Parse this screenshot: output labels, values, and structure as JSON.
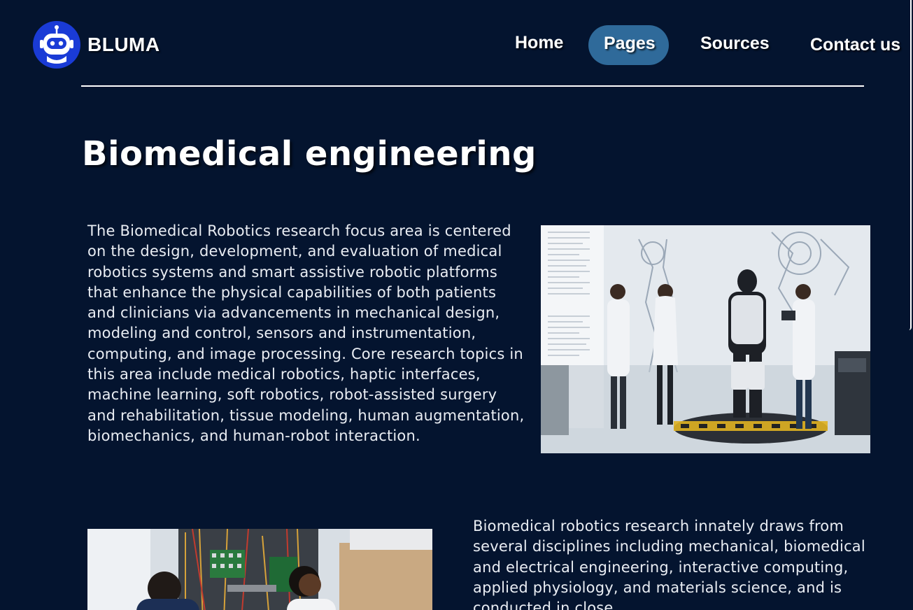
{
  "header": {
    "brand": "BLUMA",
    "logo_icon": "robot-icon",
    "nav": [
      "Home",
      "Pages",
      "Sources",
      "Contact us"
    ],
    "active_nav": "Pages"
  },
  "main": {
    "title": "Biomedical engineering",
    "paragraph1": "The Biomedical Robotics research focus area is centered on the design, development, and evaluation of medical robotics systems and smart assistive robotic platforms that enhance the physical capabilities of both patients and clinicians via advancements in mechanical design, modeling and control, sensors and instrumentation, computing, and image processing. Core research topics in this area include medical robotics, haptic interfaces, machine learning, soft robotics, robot-assisted surgery and rehabilitation, tissue modeling, human augmentation, biomechanics, and human-robot interaction.",
    "paragraph2": "Biomedical robotics research innately draws from several disciplines including mechanical, biomedical and electrical engineering, interactive computing, applied physiology, and materials science, and is conducted in close"
  },
  "colors": {
    "background": "#04142f",
    "logo": "#1a3bd6",
    "active_pill": "#2f6a9a",
    "text": "#ffffff"
  }
}
